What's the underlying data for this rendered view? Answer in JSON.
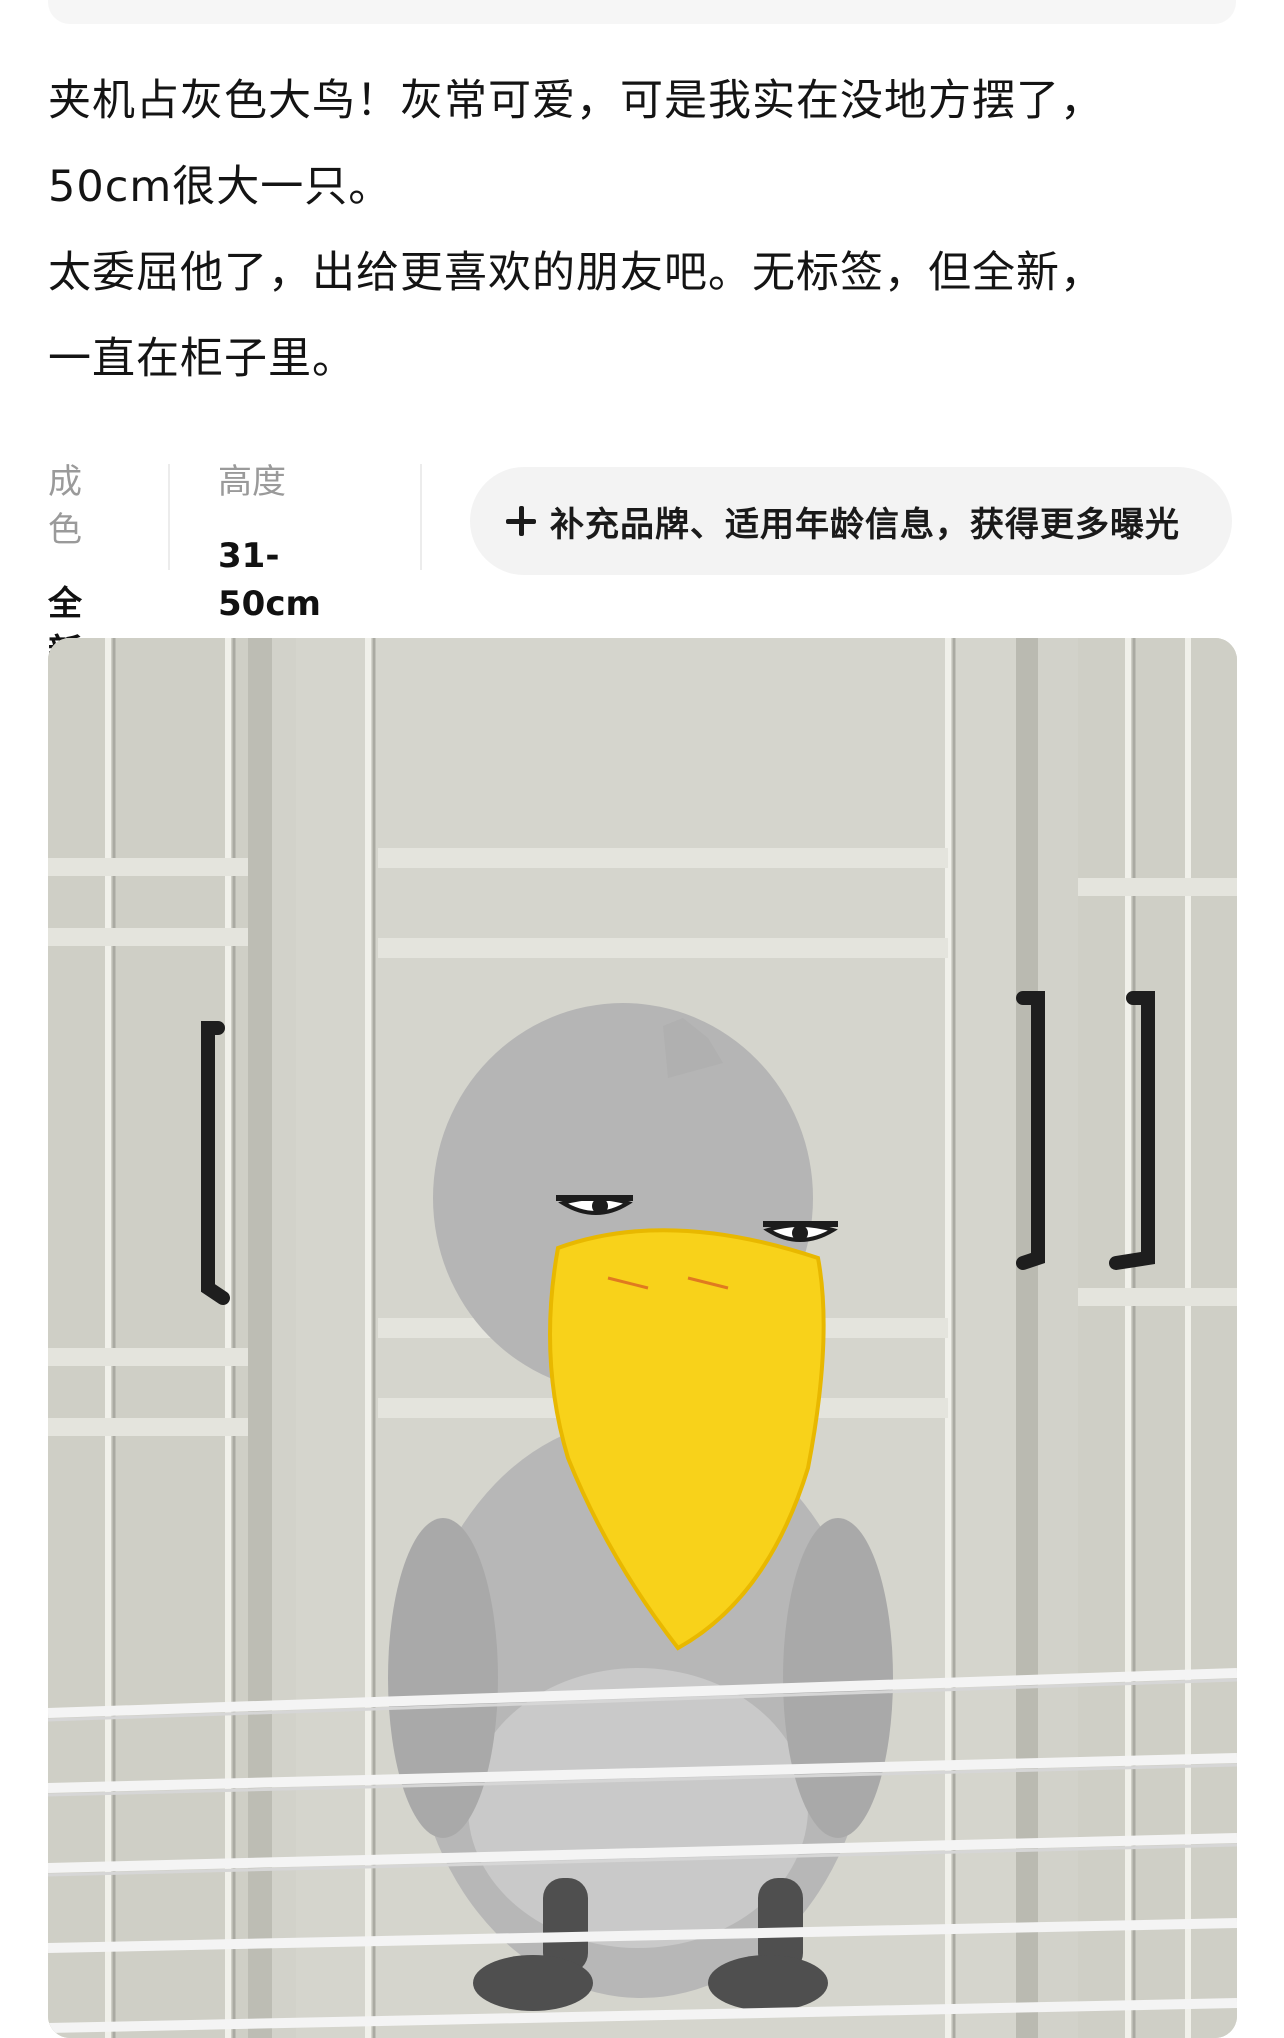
{
  "description": {
    "lines": [
      "夹机占灰色大鸟！灰常可爱，可是我实在没地方摆了，",
      "50cm很大一只。",
      "太委屈他了，出给更喜欢的朋友吧。无标签，但全新，",
      "一直在柜子里。"
    ]
  },
  "attributes": [
    {
      "label": "成色",
      "value": "全新"
    },
    {
      "label": "高度",
      "value": "31-50cm"
    }
  ],
  "supplement_button": {
    "icon": "plus-icon",
    "label": "补充品牌、适用年龄信息，获得更多曝光"
  },
  "photo": {
    "subject": "gray shoebill bird plush toy with yellow beak"
  },
  "colors": {
    "pill_bg": "#f3f3f3",
    "label_gray": "#9a9a9a",
    "beak": "#f8d21a",
    "plush": "#b8b8b8"
  }
}
